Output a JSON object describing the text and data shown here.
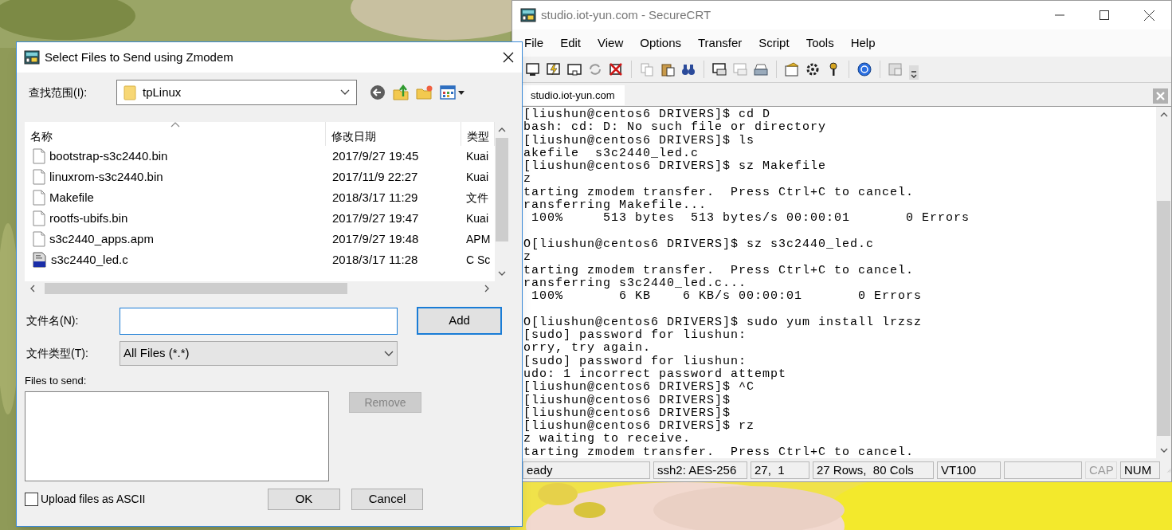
{
  "dialog": {
    "title": "Select Files to Send using Zmodem",
    "look_in": {
      "label": "查找范围(I):",
      "value": "tpLinux"
    },
    "file_list": {
      "columns": [
        {
          "label": "名称",
          "sorted": true
        },
        {
          "label": "修改日期",
          "sorted": false
        },
        {
          "label": "类型",
          "sorted": false
        }
      ],
      "rows": [
        {
          "name": "bootstrap-s3c2440.bin",
          "modified": "2017/9/27 19:45",
          "type": "Kuai",
          "kind": "document"
        },
        {
          "name": "linuxrom-s3c2440.bin",
          "modified": "2017/11/9 22:27",
          "type": "Kuai",
          "kind": "document"
        },
        {
          "name": "Makefile",
          "modified": "2018/3/17 11:29",
          "type": "文件",
          "kind": "document"
        },
        {
          "name": "rootfs-ubifs.bin",
          "modified": "2017/9/27 19:47",
          "type": "Kuai",
          "kind": "document"
        },
        {
          "name": "s3c2440_apps.apm",
          "modified": "2017/9/27 19:48",
          "type": "APM",
          "kind": "document"
        },
        {
          "name": "s3c2440_led.c",
          "modified": "2018/3/17 11:28",
          "type": "C Sc",
          "kind": "c-source"
        }
      ]
    },
    "file_name": {
      "label": "文件名(N):"
    },
    "file_type": {
      "label": "文件类型(T):",
      "value": "All Files (*.*)"
    },
    "files_to_send_label": "Files to send:",
    "add_button": {
      "label": "Add",
      "default": true
    },
    "remove_button": {
      "label": "Remove",
      "disabled": true
    },
    "ascii_checkbox": {
      "label": "Upload files as ASCII",
      "checked": false
    },
    "ok_button": {
      "label": "OK"
    },
    "cancel_button": {
      "label": "Cancel"
    }
  },
  "terminal": {
    "title": "studio.iot-yun.com - SecureCRT",
    "menu": [
      "File",
      "Edit",
      "View",
      "Options",
      "Transfer",
      "Script",
      "Tools",
      "Help"
    ],
    "session_tab": "studio.iot-yun.com",
    "lines": [
      {
        "kind": "text",
        "text": "[liushun@centos6 DRIVERS]$ cd D"
      },
      {
        "kind": "text",
        "text": "bash: cd: D: No such file or directory"
      },
      {
        "kind": "text",
        "text": "[liushun@centos6 DRIVERS]$ ls"
      },
      {
        "kind": "text",
        "text": "akefile  s3c2440_led.c"
      },
      {
        "kind": "text",
        "text": "[liushun@centos6 DRIVERS]$ sz Makefile"
      },
      {
        "kind": "text",
        "text": "z"
      },
      {
        "kind": "text",
        "text": "tarting zmodem transfer.  Press Ctrl+C to cancel."
      },
      {
        "kind": "text",
        "text": "ransferring Makefile..."
      },
      {
        "kind": "text",
        "text": " 100%     513 bytes  513 bytes/s 00:00:01       0 Errors"
      },
      {
        "kind": "blank"
      },
      {
        "kind": "text",
        "text": "O[liushun@centos6 DRIVERS]$ sz s3c2440_led.c"
      },
      {
        "kind": "text",
        "text": "z"
      },
      {
        "kind": "text",
        "text": "tarting zmodem transfer.  Press Ctrl+C to cancel."
      },
      {
        "kind": "text",
        "text": "ransferring s3c2440_led.c..."
      },
      {
        "kind": "text",
        "text": " 100%       6 KB    6 KB/s 00:00:01       0 Errors"
      },
      {
        "kind": "blank"
      },
      {
        "kind": "text",
        "text": "O[liushun@centos6 DRIVERS]$ sudo yum install lrzsz"
      },
      {
        "kind": "text",
        "text": "[sudo] password for liushun:"
      },
      {
        "kind": "text",
        "text": "orry, try again."
      },
      {
        "kind": "text",
        "text": "[sudo] password for liushun:"
      },
      {
        "kind": "text",
        "text": "udo: 1 incorrect password attempt"
      },
      {
        "kind": "text",
        "text": "[liushun@centos6 DRIVERS]$ ^C"
      },
      {
        "kind": "text",
        "text": "[liushun@centos6 DRIVERS]$"
      },
      {
        "kind": "text",
        "text": "[liushun@centos6 DRIVERS]$"
      },
      {
        "kind": "text",
        "text": "[liushun@centos6 DRIVERS]$ rz"
      },
      {
        "kind": "text",
        "text": "z waiting to receive."
      },
      {
        "kind": "text",
        "text": "tarting zmodem transfer.  Press Ctrl+C to cancel."
      }
    ],
    "status_bar": [
      {
        "text": "eady",
        "disabled": false
      },
      {
        "text": "ssh2: AES-256",
        "disabled": false
      },
      {
        "text": "27,  1",
        "disabled": false
      },
      {
        "text": "27 Rows,  80 Cols",
        "disabled": false
      },
      {
        "text": "VT100",
        "disabled": false
      },
      {
        "disabled": false
      },
      {
        "text": "CAP",
        "disabled": true
      },
      {
        "text": "NUM",
        "disabled": false
      }
    ]
  }
}
